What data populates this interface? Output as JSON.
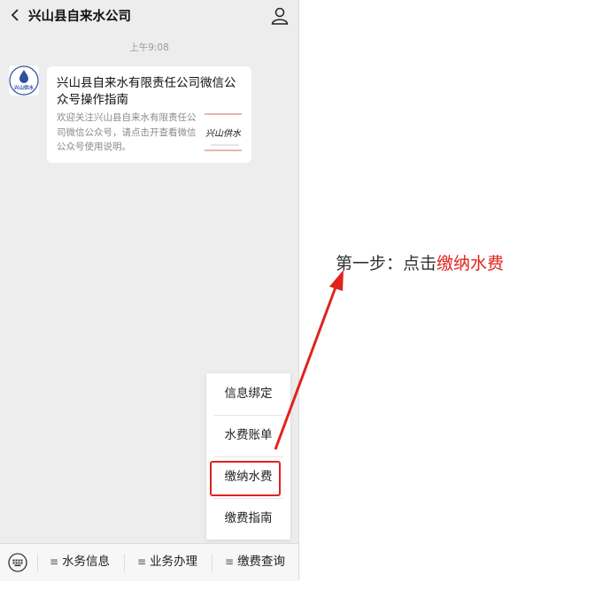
{
  "header": {
    "title": "兴山县自来水公司"
  },
  "chat": {
    "time": "上午9:08",
    "avatar_text": "兴山供水",
    "card": {
      "title": "兴山县自来水有限责任公司微信公众号操作指南",
      "description": "欢迎关注兴山县自来水有限责任公司微信公众号，请点击开查看微信公众号使用说明。",
      "thumb_text": "兴山供水"
    }
  },
  "menu": {
    "items": [
      {
        "label": "信息绑定"
      },
      {
        "label": "水费账单"
      },
      {
        "label": "缴纳水费"
      },
      {
        "label": "缴费指南"
      }
    ]
  },
  "bottom_bar": {
    "tabs": [
      {
        "label": "水务信息"
      },
      {
        "label": "业务办理"
      },
      {
        "label": "缴费查询"
      }
    ]
  },
  "annotation": {
    "prefix": "第一步：点击",
    "highlight": "缴纳水费"
  },
  "colors": {
    "accent_red": "#e0231e",
    "chat_bg": "#ededed"
  },
  "icons": [
    "back-arrow-icon",
    "user-icon",
    "keyboard-icon",
    "menu-lines-icon"
  ]
}
